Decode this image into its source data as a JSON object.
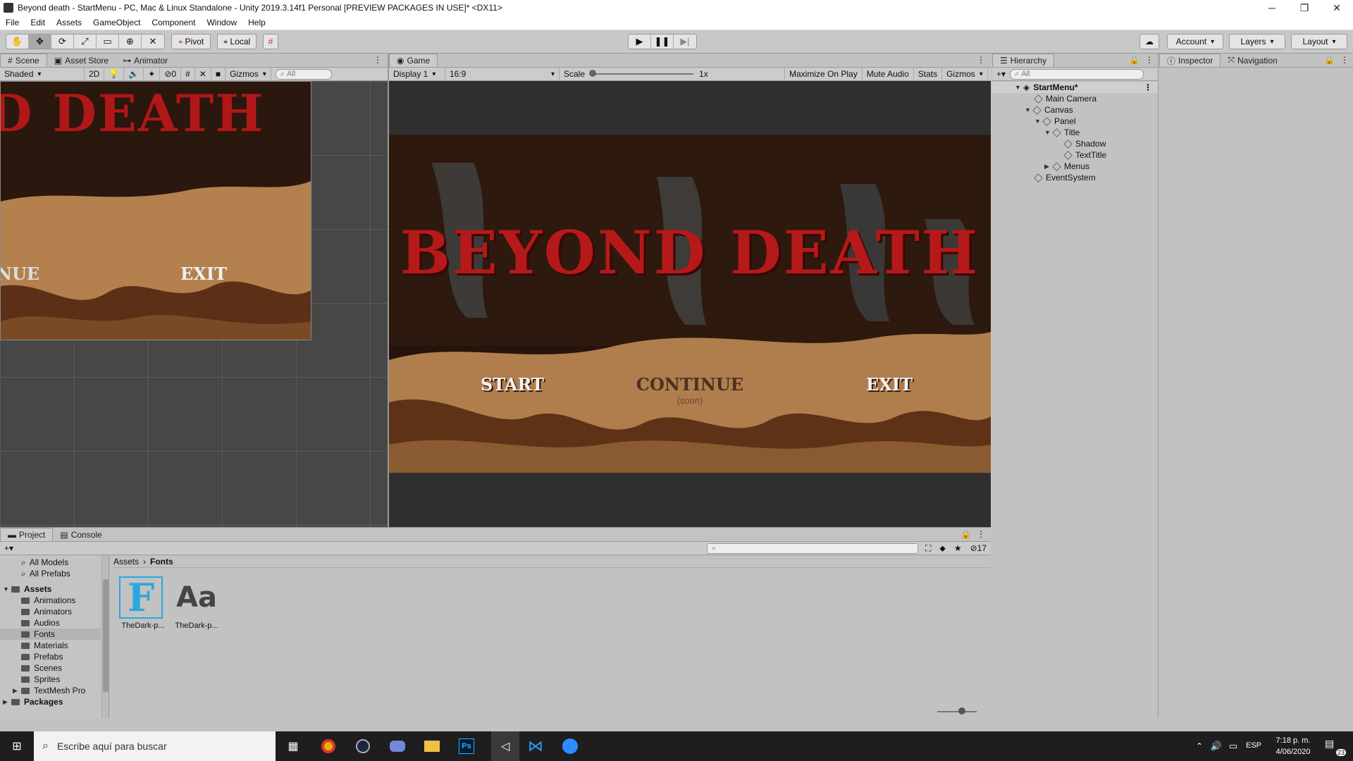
{
  "window": {
    "title": "Beyond death - StartMenu - PC, Mac & Linux Standalone - Unity 2019.3.14f1 Personal [PREVIEW PACKAGES IN USE]* <DX11>",
    "controls": [
      "─",
      "❐",
      "✕"
    ]
  },
  "menu": [
    "File",
    "Edit",
    "Assets",
    "GameObject",
    "Component",
    "Window",
    "Help"
  ],
  "toolbar": {
    "pivot": "Pivot",
    "local": "Local",
    "account": "Account",
    "layers": "Layers",
    "layout": "Layout"
  },
  "scene": {
    "tabs": [
      "Scene",
      "Asset Store",
      "Animator"
    ],
    "shading": "Shaded",
    "mode_2d": "2D",
    "hidden_count": "0",
    "gizmos": "Gizmos",
    "search_placeholder": "All",
    "preview_title": "D DEATH",
    "preview_continue": "NUE",
    "preview_exit": "EXIT"
  },
  "game": {
    "tab": "Game",
    "display": "Display 1",
    "aspect": "16:9",
    "scale_label": "Scale",
    "scale_value": "1x",
    "maximize": "Maximize On Play",
    "mute": "Mute Audio",
    "stats": "Stats",
    "gizmos": "Gizmos",
    "title_text": "BEYOND DEATH",
    "start": "START",
    "continue": "CONTINUE",
    "continue_sub": "(soon)",
    "exit": "EXIT"
  },
  "hierarchy": {
    "tab": "Hierarchy",
    "search_placeholder": "All",
    "items": [
      {
        "label": "StartMenu*",
        "depth": 0
      },
      {
        "label": "Main Camera",
        "depth": 1
      },
      {
        "label": "Canvas",
        "depth": 1
      },
      {
        "label": "Panel",
        "depth": 2
      },
      {
        "label": "Title",
        "depth": 3
      },
      {
        "label": "Shadow",
        "depth": 4
      },
      {
        "label": "TextTitle",
        "depth": 4
      },
      {
        "label": "Menus",
        "depth": 3
      },
      {
        "label": "EventSystem",
        "depth": 1
      }
    ]
  },
  "inspector": {
    "tabs": [
      "Inspector",
      "Navigation"
    ]
  },
  "project": {
    "tabs": [
      "Project",
      "Console"
    ],
    "hidden_count": "17",
    "breadcrumb": [
      "Assets",
      "Fonts"
    ],
    "favorites": [
      "All Models",
      "All Prefabs"
    ],
    "tree_root": "Assets",
    "folders": [
      "Animations",
      "Animators",
      "Audios",
      "Fonts",
      "Materials",
      "Prefabs",
      "Scenes",
      "Sprites",
      "TextMesh Pro"
    ],
    "packages": "Packages",
    "assets": [
      {
        "name": "TheDark-p...",
        "glyph": "F"
      },
      {
        "name": "TheDark-p...",
        "glyph": "Aa"
      }
    ]
  },
  "taskbar": {
    "search_placeholder": "Escribe aquí para buscar",
    "lang": "ESP",
    "time": "7:18 p. m.",
    "date": "4/06/2020",
    "notifications": "23"
  }
}
